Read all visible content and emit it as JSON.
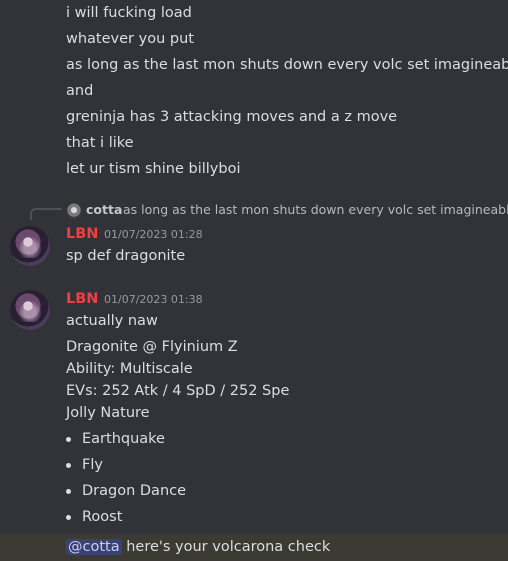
{
  "top_message_lines": [
    "i will fucking load",
    "whatever you put",
    "as long as the last mon shuts down every volc set imagineable",
    "and",
    "greninja has 3 attacking moves and a z move",
    "that i like",
    "let ur tism shine billyboi"
  ],
  "reply": {
    "name": "cotta",
    "text": "as long as the last mon shuts down every volc set imagineable"
  },
  "message1": {
    "author": "LBN",
    "timestamp": "01/07/2023 01:28",
    "text": "sp def dragonite"
  },
  "message2": {
    "author": "LBN",
    "timestamp": "01/07/2023 01:38",
    "lines": [
      "actually naw",
      "Dragonite @ Flyinium Z",
      "Ability: Multiscale",
      "EVs: 252 Atk / 4 SpD / 252 Spe",
      "Jolly Nature"
    ],
    "moves": [
      "Earthquake",
      "Fly",
      "Dragon Dance",
      "Roost"
    ],
    "mention": "@cotta",
    "final_text": " here's your volcarona check"
  },
  "colors": {
    "background": "#313338",
    "username": "#f23f43",
    "mention_bg": "#3c4270",
    "highlight_bg": "#3b3a33"
  }
}
